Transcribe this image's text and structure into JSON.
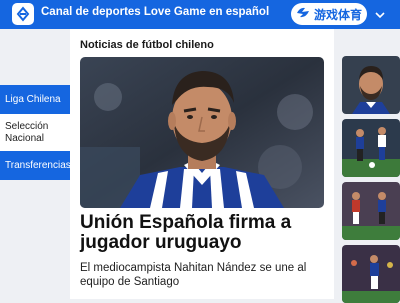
{
  "header": {
    "title": "Canal de deportes Love Game en español",
    "brand_label": "游戏体育",
    "colors": {
      "primary": "#1566e0"
    },
    "icons": [
      "app-logo-icon",
      "brand-logo-icon",
      "chevron-down-icon"
    ]
  },
  "nav": {
    "items": [
      {
        "label": "Liga Chilena",
        "active": true
      },
      {
        "label": "Selección Nacional",
        "active": false
      },
      {
        "label": "Transferencias",
        "active": true
      }
    ]
  },
  "main": {
    "section_title": "Noticias de fútbol chileno",
    "headline": "Unión Española firma a jugador uruguayo",
    "summary": "El mediocampista Nahitan Nández se une al equipo de Santiago"
  }
}
